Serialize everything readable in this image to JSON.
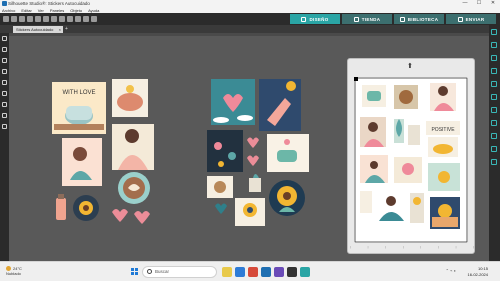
{
  "window": {
    "title": "Silhouette Studio®: Stickers Autocuidado",
    "controls": [
      "—",
      "☐",
      "✕"
    ]
  },
  "menu": [
    "Archivo",
    "Editar",
    "Ver",
    "Paneles",
    "Objeto",
    "Ayuda"
  ],
  "tabs": [
    {
      "label": "DISEÑO",
      "active": true
    },
    {
      "label": "TIENDA",
      "active": false
    },
    {
      "label": "BIBLIOTECA",
      "active": false
    },
    {
      "label": "ENVIAR",
      "active": false
    }
  ],
  "document_tab": {
    "name": "Stickers Autocuidado",
    "close": "×",
    "add": "+"
  },
  "stickers": [
    {
      "name": "with-love-coffee",
      "text": "WITH LOVE"
    },
    {
      "name": "positive-sticker",
      "text": "POSITIVE"
    }
  ],
  "taskbar": {
    "weather_temp": "24°C",
    "weather_desc": "Nublado",
    "search_placeholder": "Buscar",
    "time": "10:15",
    "date": "16-02-2024"
  },
  "colors": {
    "accent": "#2aa5a5",
    "canvas": "#595959",
    "toolbar": "#2b2b2b"
  }
}
